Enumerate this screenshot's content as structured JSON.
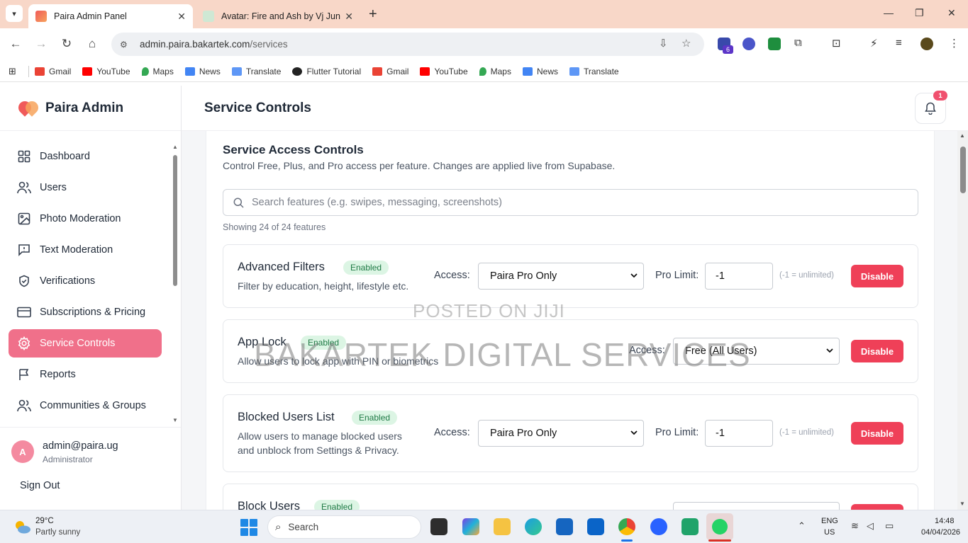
{
  "browser": {
    "tabs": [
      {
        "title": "Paira Admin Panel",
        "active": true
      },
      {
        "title": "Avatar: Fire and Ash by Vj Junio",
        "active": false
      }
    ],
    "url_host": "admin.paira.bakartek.com",
    "url_path": "/services",
    "extension_badge": "6",
    "bookmarks": [
      {
        "label": "Gmail",
        "icon": "gmail-icon"
      },
      {
        "label": "YouTube",
        "icon": "youtube-icon"
      },
      {
        "label": "Maps",
        "icon": "maps-icon"
      },
      {
        "label": "News",
        "icon": "news-icon"
      },
      {
        "label": "Translate",
        "icon": "translate-icon"
      },
      {
        "label": "Flutter Tutorial",
        "icon": "globe-icon"
      },
      {
        "label": "Gmail",
        "icon": "gmail-icon"
      },
      {
        "label": "YouTube",
        "icon": "youtube-icon"
      },
      {
        "label": "Maps",
        "icon": "maps-icon"
      },
      {
        "label": "News",
        "icon": "news-icon"
      },
      {
        "label": "Translate",
        "icon": "translate-icon"
      }
    ]
  },
  "brand": {
    "name": "Paira Admin"
  },
  "sidebar": {
    "items": [
      {
        "label": "Dashboard",
        "icon": "dashboard-icon",
        "active": false
      },
      {
        "label": "Users",
        "icon": "users-icon",
        "active": false
      },
      {
        "label": "Photo Moderation",
        "icon": "image-icon",
        "active": false
      },
      {
        "label": "Text Moderation",
        "icon": "message-icon",
        "active": false
      },
      {
        "label": "Verifications",
        "icon": "shield-icon",
        "active": false
      },
      {
        "label": "Subscriptions & Pricing",
        "icon": "card-icon",
        "active": false
      },
      {
        "label": "Service Controls",
        "icon": "gear-icon",
        "active": true
      },
      {
        "label": "Reports",
        "icon": "flag-icon",
        "active": false
      },
      {
        "label": "Communities & Groups",
        "icon": "users-icon",
        "active": false
      }
    ]
  },
  "profile": {
    "initial": "A",
    "email": "admin@paira.ug",
    "role": "Administrator",
    "signout": "Sign Out"
  },
  "header": {
    "title": "Service Controls",
    "notification_count": "1"
  },
  "section": {
    "title": "Service Access Controls",
    "subtitle": "Control Free, Plus, and Pro access per feature. Changes are applied live from Supabase.",
    "search_placeholder": "Search features (e.g. swipes, messaging, screenshots)",
    "showing": "Showing 24 of 24 features"
  },
  "features": [
    {
      "name": "Advanced Filters",
      "status": "Enabled",
      "desc": [
        "Filter by education, height, lifestyle etc."
      ],
      "access_label": "Access:",
      "access": "Paira Pro Only",
      "limit_label": "Pro Limit:",
      "limit": "-1",
      "hint": "(-1 = unlimited)",
      "action": "Disable"
    },
    {
      "name": "App Lock",
      "status": "Enabled",
      "desc": [
        "Allow users to lock app with PIN or biometrics"
      ],
      "access_label": "Access:",
      "access": "Free (All Users)",
      "action": "Disable"
    },
    {
      "name": "Blocked Users List",
      "status": "Enabled",
      "desc": [
        "Allow users to manage blocked users",
        "and unblock from Settings & Privacy."
      ],
      "access_label": "Access:",
      "access": "Paira Pro Only",
      "limit_label": "Pro Limit:",
      "limit": "-1",
      "hint": "(-1 = unlimited)",
      "action": "Disable"
    },
    {
      "name": "Block Users",
      "status": "Enabled"
    }
  ],
  "watermark": {
    "line1": "POSTED ON JIJI",
    "line2": "BAKARTEK DIGITAL SERVICES"
  },
  "taskbar": {
    "weather_temp": "29°C",
    "weather_desc": "Partly sunny",
    "search_label": "Search",
    "lang_line1": "ENG",
    "lang_line2": "US",
    "time": "14:48",
    "date": "04/04/2026"
  },
  "colors": {
    "accent": "#f0708a",
    "danger": "#ef4058",
    "enabled_badge_bg": "#dcf5e4",
    "enabled_badge_text": "#1f7a45",
    "tabbar": "#f8d7c8"
  }
}
